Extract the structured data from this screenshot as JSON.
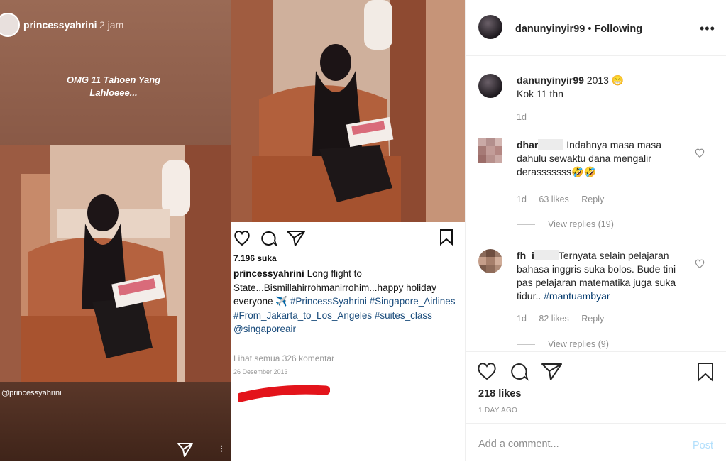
{
  "story": {
    "username": "princessyahrini",
    "time": "2 jam",
    "caption": "OMG 11 Tahoen Yang Lahloeee...",
    "mention": "@princessyahrini"
  },
  "old_post": {
    "likes": "7.196 suka",
    "caption_user": "princessyahrini",
    "caption_text": "Long flight to State...Bismillahirrohmanirrohim...happy holiday everyone ✈️",
    "hashtags": "#PrincessSyahrini #Singapore_Airlines #From_Jakarta_to_Los_Angeles #suites_class @singaporeair",
    "see_all": "Lihat semua 326 komentar",
    "date": "26 Desember 2013"
  },
  "header": {
    "username": "danunyinyir99",
    "status": "Following",
    "separator": "•",
    "more": "•••"
  },
  "comments": [
    {
      "user": "danunyinyir99",
      "text_line1": "2013 😁",
      "text_line2": "Kok 11 thn",
      "age": "1d"
    },
    {
      "user": "dhar",
      "text": "Indahnya masa masa dahulu sewaktu dana mengalir derasssssss🤣🤣",
      "age": "1d",
      "likes": "63 likes",
      "reply": "Reply",
      "view_replies": "View replies (19)"
    },
    {
      "user": "fh_i",
      "text": "Ternyata selain pelajaran bahasa inggris suka bolos. Bude tini pas pelajaran matematika juga suka tidur..",
      "hashtag": "#mantuambyar",
      "age": "1d",
      "likes": "82 likes",
      "reply": "Reply",
      "view_replies": "View replies (9)"
    }
  ],
  "actions": {
    "likes": "218 likes",
    "posted": "1 DAY AGO"
  },
  "add_comment": {
    "placeholder": "Add a comment...",
    "post_label": "Post"
  }
}
